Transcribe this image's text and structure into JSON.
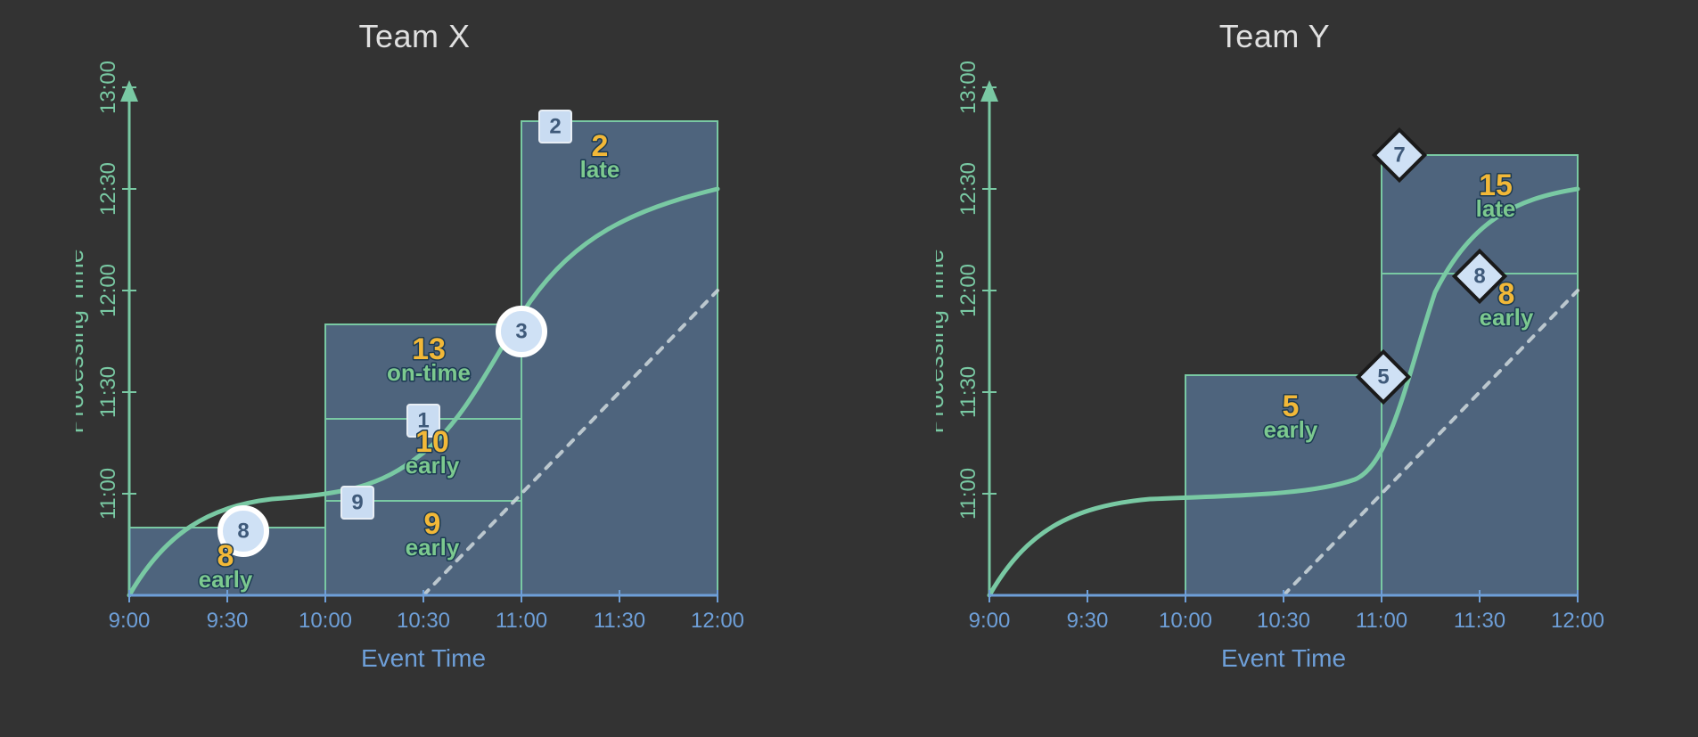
{
  "axes": {
    "x_label": "Event Time",
    "y_label": "Processing Time",
    "x_ticks": [
      "9:00",
      "9:30",
      "10:00",
      "10:30",
      "11:00",
      "11:30",
      "12:00"
    ],
    "y_ticks": [
      "11:00",
      "11:30",
      "12:00",
      "12:30",
      "13:00"
    ]
  },
  "panels": {
    "left": {
      "title": "Team X"
    },
    "right": {
      "title": "Team Y"
    }
  },
  "teamX": {
    "win1": {
      "value": "8",
      "status": "early"
    },
    "win2a": {
      "value": "9",
      "status": "early",
      "marker": "9"
    },
    "win2b": {
      "value": "10",
      "status": "early",
      "marker": "1"
    },
    "win2c": {
      "value": "13",
      "status": "on-time",
      "marker": "3"
    },
    "win3": {
      "value": "2",
      "status": "late",
      "marker": "2"
    },
    "marker8": "8"
  },
  "teamY": {
    "win1": {
      "value": "5",
      "status": "early",
      "marker": "5"
    },
    "win2a": {
      "value": "8",
      "status": "early",
      "marker": "8"
    },
    "win2b": {
      "value": "15",
      "status": "late",
      "marker": "7"
    }
  },
  "chart_data": [
    {
      "type": "area",
      "title": "Team X",
      "xlabel": "Event Time",
      "ylabel": "Processing Time",
      "x_range": [
        "9:00",
        "12:00"
      ],
      "y_range": [
        "10:30",
        "13:00"
      ],
      "windows": [
        {
          "event_start": "9:00",
          "event_end": "10:00",
          "processing_top": "10:50",
          "panes": [
            {
              "sum": 8,
              "timing": "early"
            }
          ],
          "events": [
            {
              "value": 8,
              "event_time": "9:35",
              "processing_time": "10:45",
              "shape": "circle"
            }
          ]
        },
        {
          "event_start": "10:00",
          "event_end": "11:00",
          "processing_top": "11:50",
          "panes": [
            {
              "sum": 9,
              "timing": "early"
            },
            {
              "sum": 10,
              "timing": "early"
            },
            {
              "sum": 13,
              "timing": "on-time"
            }
          ],
          "events": [
            {
              "value": 9,
              "event_time": "10:15",
              "processing_time": "10:58",
              "shape": "square"
            },
            {
              "value": 1,
              "event_time": "10:30",
              "processing_time": "11:22",
              "shape": "square"
            },
            {
              "value": 3,
              "event_time": "11:00",
              "processing_time": "11:45",
              "shape": "circle"
            }
          ]
        },
        {
          "event_start": "11:00",
          "event_end": "12:00",
          "processing_top": "12:50",
          "panes": [
            {
              "sum": 2,
              "timing": "late"
            }
          ],
          "events": [
            {
              "value": 2,
              "event_time": "11:15",
              "processing_time": "12:48",
              "shape": "square"
            }
          ]
        }
      ],
      "watermark": "monotonic curve from (9:00,10:30) rising steeply to ~11:00 by 10:00, then to ~12:30 by 12:00",
      "ideal_line": {
        "from": [
          "10:30",
          "10:30"
        ],
        "to": [
          "12:00",
          "12:00"
        ]
      }
    },
    {
      "type": "area",
      "title": "Team Y",
      "xlabel": "Event Time",
      "ylabel": "Processing Time",
      "x_range": [
        "9:00",
        "12:00"
      ],
      "y_range": [
        "10:30",
        "13:00"
      ],
      "windows": [
        {
          "event_start": "10:00",
          "event_end": "11:00",
          "processing_top": "11:35",
          "panes": [
            {
              "sum": 5,
              "timing": "early"
            }
          ],
          "events": [
            {
              "value": 5,
              "event_time": "11:00",
              "processing_time": "11:35",
              "shape": "diamond"
            }
          ]
        },
        {
          "event_start": "11:00",
          "event_end": "12:00",
          "processing_top": "12:40",
          "panes": [
            {
              "sum": 8,
              "timing": "early"
            },
            {
              "sum": 15,
              "timing": "late"
            }
          ],
          "events": [
            {
              "value": 8,
              "event_time": "11:30",
              "processing_time": "12:05",
              "shape": "diamond"
            },
            {
              "value": 7,
              "event_time": "11:10",
              "processing_time": "12:38",
              "shape": "diamond"
            }
          ]
        }
      ],
      "watermark": "monotonic curve from (9:00,10:30) rising steeply to ~11:00 by 10:00, flat, then s-curve to ~12:30 by 12:00",
      "ideal_line": {
        "from": [
          "10:30",
          "10:30"
        ],
        "to": [
          "12:00",
          "12:00"
        ]
      }
    }
  ]
}
